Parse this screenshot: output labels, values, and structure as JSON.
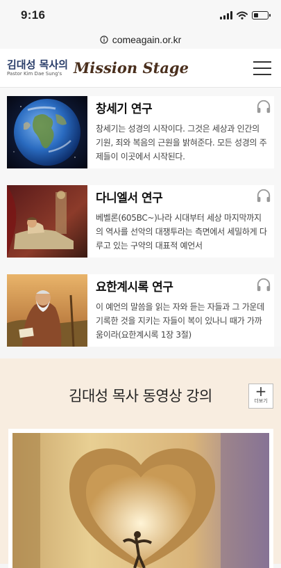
{
  "status_bar": {
    "time": "9:16",
    "battery_level": 0.35
  },
  "url_bar": {
    "url": "comeagain.or.kr"
  },
  "header": {
    "logo_korean": "김대성 목사의",
    "logo_english_small": "Pastor Kim Dae Sung's",
    "logo_title": "Mission Stage"
  },
  "studies": [
    {
      "title": "창세기 연구",
      "description": "창세기는 성경의 시작이다. 그것은 세상과 인간의 기원, 죄와 복음의 근원을 밝혀준다. 모든 성경의 주제들이 이곳에서 시작된다.",
      "image": "earth-globe-image"
    },
    {
      "title": "다니엘서 연구",
      "description": "베벨론(605BC~)나라 시대부터 세상 마지막까지의 역사를 선악의 대쟁투라는 측면에서 세밀하게 다루고 있는 구약의 대표적 예언서",
      "image": "daniel-dream-image"
    },
    {
      "title": "요한계시록 연구",
      "description": "이 예언의 말씀을 읽는 자와 듣는 자들과 그 가운데 기록한 것을 지키는 자들이 복이 있나니 때가 가까움이라(요한계시록 1장 3절)",
      "image": "john-patmos-image"
    }
  ],
  "video_section": {
    "title": "김대성 목사 동영상 강의",
    "more_label": "더보기",
    "more_icon": "plus-icon"
  },
  "icons": {
    "audio": "headphones-icon",
    "menu": "hamburger-icon",
    "info": "info-circle-icon"
  },
  "colors": {
    "logo_blue": "#2a3e6a",
    "logo_brown": "#4a2f1d",
    "video_bg": "#f8ede0"
  }
}
